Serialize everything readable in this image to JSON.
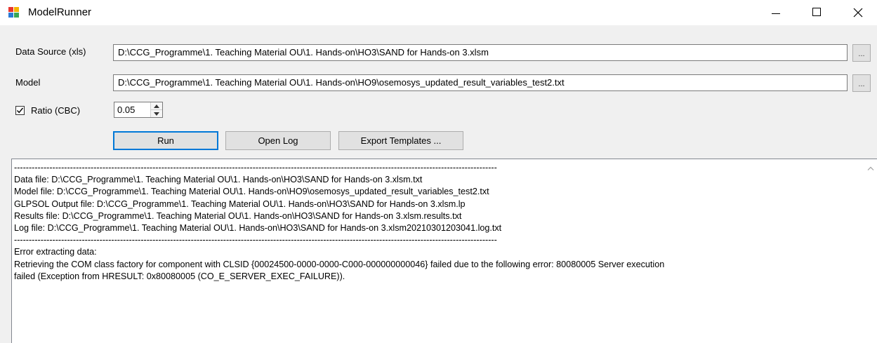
{
  "window": {
    "title": "ModelRunner",
    "icon": "app-icon"
  },
  "form": {
    "data_source_label": "Data Source (xls)",
    "data_source_value": "D:\\CCG_Programme\\1. Teaching Material OU\\1. Hands-on\\HO3\\SAND for Hands-on 3.xlsm",
    "model_label": "Model",
    "model_value": "D:\\CCG_Programme\\1. Teaching Material OU\\1. Hands-on\\HO9\\osemosys_updated_result_variables_test2.txt",
    "browse_label": "...",
    "ratio_label": "Ratio (CBC)",
    "ratio_checked": true,
    "ratio_value": "0.05"
  },
  "buttons": {
    "run": "Run",
    "open_log": "Open Log",
    "export": "Export Templates ..."
  },
  "log": {
    "lines": [
      "--------------------------------------------------------------------------------------------------------------------------------------------------------------------",
      "Data file: D:\\CCG_Programme\\1. Teaching Material OU\\1. Hands-on\\HO3\\SAND for Hands-on 3.xlsm.txt",
      "Model file: D:\\CCG_Programme\\1. Teaching Material OU\\1. Hands-on\\HO9\\osemosys_updated_result_variables_test2.txt",
      "GLPSOL Output file: D:\\CCG_Programme\\1. Teaching Material OU\\1. Hands-on\\HO3\\SAND for Hands-on 3.xlsm.lp",
      "Results file: D:\\CCG_Programme\\1. Teaching Material OU\\1. Hands-on\\HO3\\SAND for Hands-on 3.xlsm.results.txt",
      "Log file: D:\\CCG_Programme\\1. Teaching Material OU\\1. Hands-on\\HO3\\SAND for Hands-on 3.xlsm20210301203041.log.txt",
      "--------------------------------------------------------------------------------------------------------------------------------------------------------------------",
      "Error extracting data:",
      "Retrieving the COM class factory for component with CLSID {00024500-0000-0000-C000-000000000046} failed due to the following error: 80080005 Server execution",
      "failed (Exception from HRESULT: 0x80080005 (CO_E_SERVER_EXEC_FAILURE))."
    ]
  }
}
